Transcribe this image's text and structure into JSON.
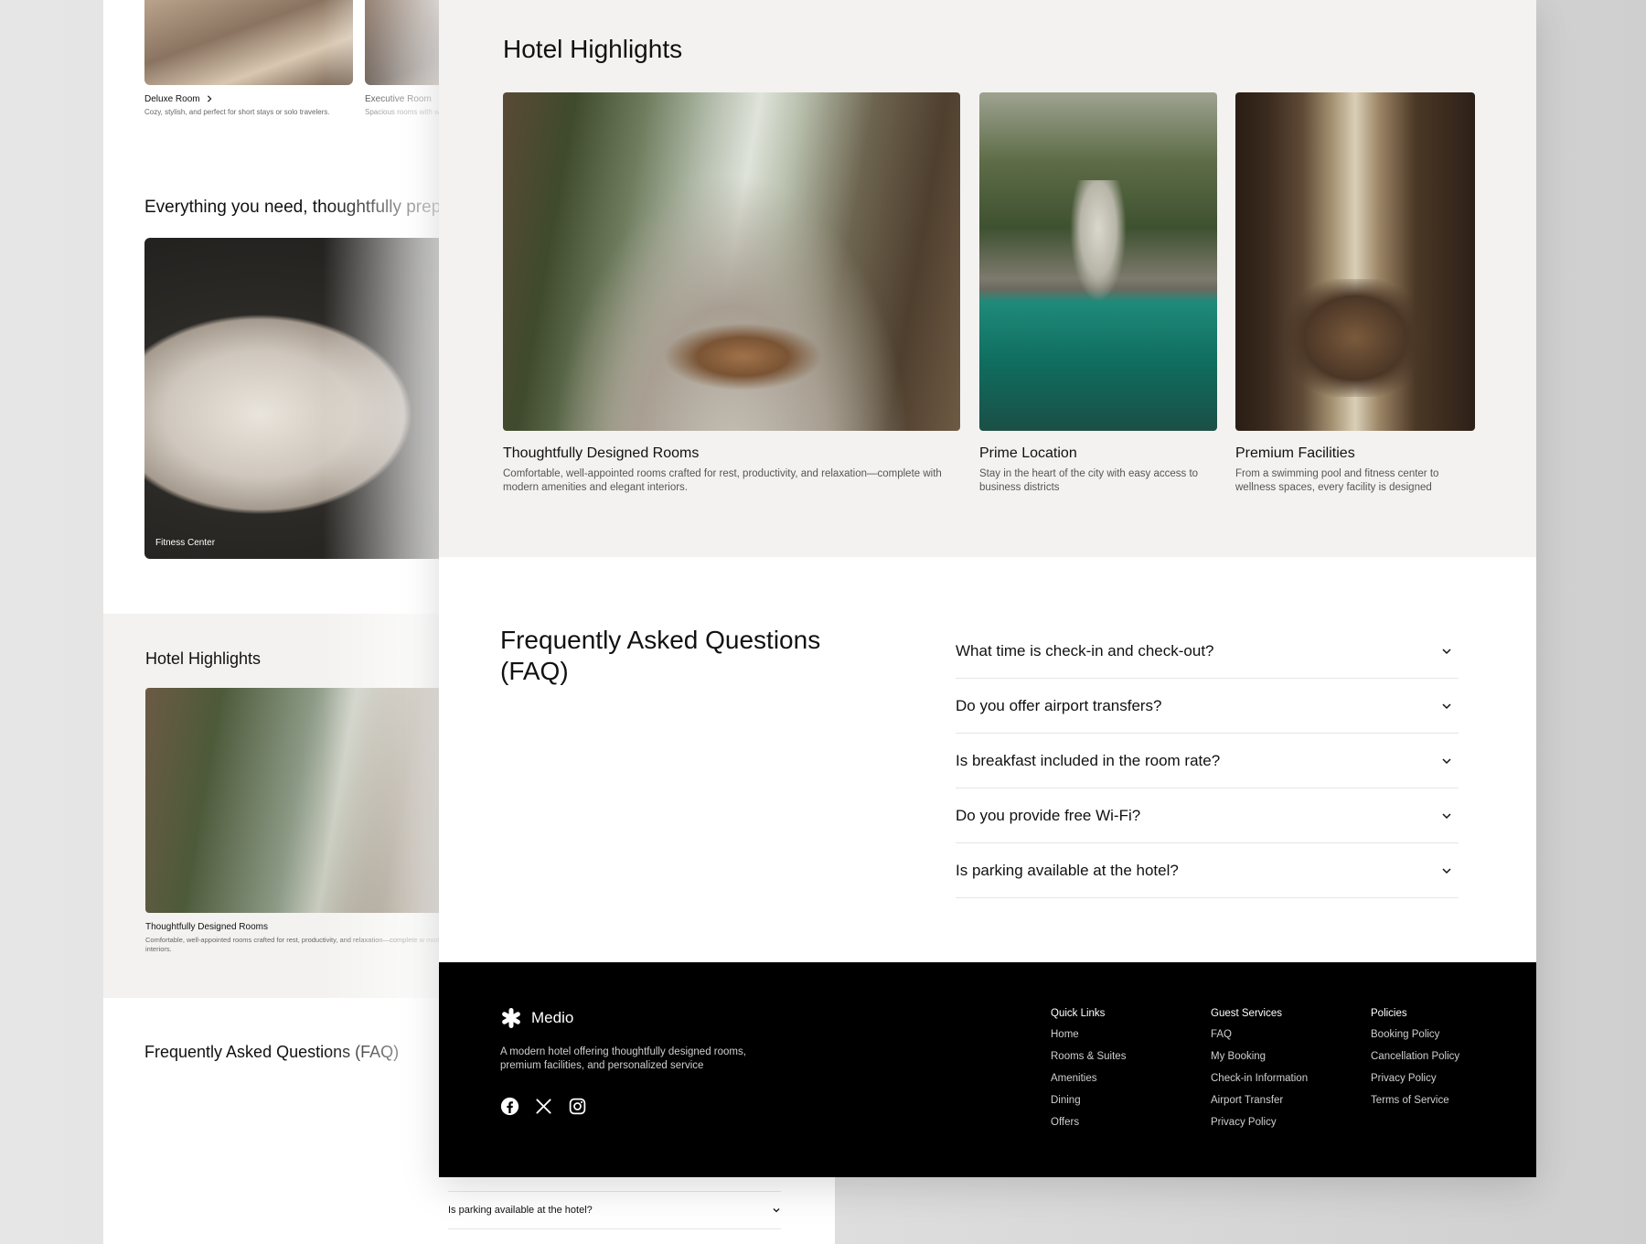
{
  "background_page": {
    "rooms": [
      {
        "title": "Deluxe Room",
        "chevron": "chevron-right-icon",
        "description": "Cozy, stylish, and perfect for short stays or solo travelers."
      },
      {
        "title": "Executive Room",
        "description": "Spacious rooms with w"
      }
    ],
    "amenities_heading": "Everything you need, thoughtfully prepa",
    "amenity_label": "Fitness Center",
    "highlights_title": "Hotel Highlights",
    "highlight_caption": "Thoughtfully Designed Rooms",
    "highlight_desc": "Comfortable, well-appointed rooms crafted for rest, productivity, and relaxation—complete w modern amenities and elegant interiors.",
    "faq_title": "Frequently Asked Questions (FAQ)",
    "faq_last": "Is parking available at the hotel?"
  },
  "highlights": {
    "title": "Hotel Highlights",
    "cards": [
      {
        "title": "Thoughtfully Designed Rooms",
        "description": "Comfortable, well-appointed rooms crafted for rest, productivity, and relaxation—complete with modern amenities and elegant interiors."
      },
      {
        "title": "Prime Location",
        "description": "Stay in the heart of the city with easy access to business districts"
      },
      {
        "title": "Premium Facilities",
        "description": "From a swimming pool and fitness center to wellness spaces, every facility is designed"
      }
    ]
  },
  "faq": {
    "title": "Frequently Asked Questions (FAQ)",
    "items": [
      {
        "question": "What time is check-in and check-out?"
      },
      {
        "question": "Do you offer airport transfers?"
      },
      {
        "question": "Is breakfast included in the room rate?"
      },
      {
        "question": "Do you provide free Wi-Fi?"
      },
      {
        "question": "Is parking available at the hotel?"
      }
    ]
  },
  "footer": {
    "brand": "Medio",
    "description": "A modern hotel offering thoughtfully designed rooms, premium facilities, and personalized service",
    "socials": [
      "facebook-icon",
      "x-icon",
      "instagram-icon"
    ],
    "columns": [
      {
        "title": "Quick Links",
        "links": [
          "Home",
          "Rooms & Suites",
          "Amenities",
          "Dining",
          "Offers"
        ]
      },
      {
        "title": "Guest Services",
        "links": [
          "FAQ",
          "My Booking",
          "Check-in Information",
          "Airport Transfer",
          "Privacy Policy"
        ]
      },
      {
        "title": "Policies",
        "links": [
          "Booking Policy",
          "Cancellation Policy",
          "Privacy Policy",
          "Terms of Service"
        ]
      }
    ]
  },
  "colors": {
    "page_bg": "#e3e3e3",
    "section_bg": "#f3f2f0",
    "footer_bg": "#000000",
    "text": "#111111",
    "muted": "#555555"
  }
}
